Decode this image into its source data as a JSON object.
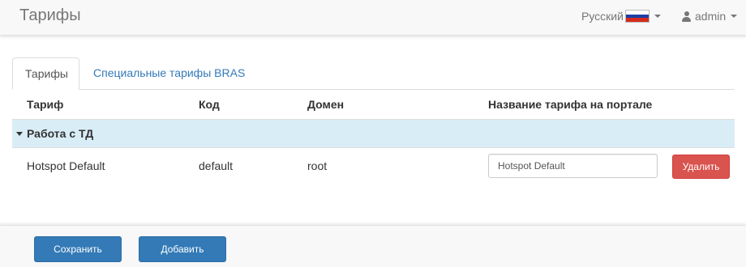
{
  "header": {
    "title": "Тарифы",
    "language": "Русский",
    "user": "admin",
    "flag_icon": "russia-flag-icon",
    "user_icon": "user-icon"
  },
  "tabs": [
    {
      "label": "Тарифы",
      "active": true
    },
    {
      "label": "Специальные тарифы BRAS",
      "active": false
    }
  ],
  "table": {
    "columns": [
      "Тариф",
      "Код",
      "Домен",
      "Название тарифа на портале"
    ],
    "groups": [
      {
        "label": "Работа с ТД",
        "expanded": true,
        "rows": [
          {
            "tariff": "Hotspot Default",
            "code": "default",
            "domain": "root",
            "portal_name": "Hotspot Default",
            "delete_label": "Удалить"
          }
        ]
      }
    ]
  },
  "footer": {
    "save_label": "Сохранить",
    "add_label": "Добавить"
  },
  "colors": {
    "primary": "#337ab7",
    "danger": "#d9534f",
    "group_row": "#d9edf7",
    "link": "#337ab7"
  }
}
